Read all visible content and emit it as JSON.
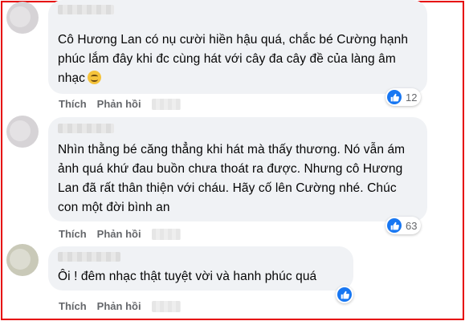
{
  "comments": [
    {
      "text": "Cô Hương Lan có nụ cười hiền hậu quá, chắc bé Cường hạnh phúc lắm đây khi đc cùng hát với cây đa cây đề của làng âm nhạc",
      "emoji": "smiling-face-emoji",
      "reaction_icon": "like-icon",
      "reaction_count": "12",
      "like_label": "Thích",
      "reply_label": "Phản hồi"
    },
    {
      "text": "Nhìn thằng bé căng thẳng khi hát mà thấy thương. Nó vẫn ám ảnh quá khứ đau buồn chưa thoát ra được. Nhưng cô Hương Lan đã rất thân thiện với cháu. Hãy cố lên Cường nhé. Chúc con một đời bình an",
      "reaction_icon": "like-icon",
      "reaction_count": "63",
      "like_label": "Thích",
      "reply_label": "Phản hồi"
    },
    {
      "text": "Ôi ! đêm nhạc thật tuyệt vời và hanh phúc quá",
      "reaction_icon": "like-icon",
      "like_label": "Thích",
      "reply_label": "Phản hồi"
    }
  ],
  "colors": {
    "frame_border": "#e60000",
    "bubble_bg": "#f0f2f5",
    "like_blue": "#1877f2",
    "action_text": "#65676b"
  }
}
